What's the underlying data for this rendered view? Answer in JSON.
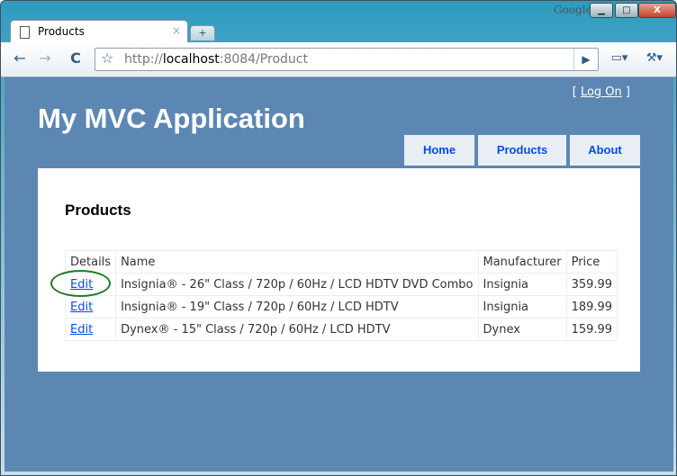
{
  "browser": {
    "brand": "Google",
    "tab_title": "Products",
    "tab_close": "×",
    "new_tab": "+",
    "url": {
      "scheme": "http://",
      "host": "localhost",
      "rest": ":8084/Product"
    },
    "window_controls": {
      "minimize": "▁",
      "maximize": "□",
      "close": "X"
    },
    "icons": {
      "back": "←",
      "forward": "→",
      "reload": "C",
      "bookmark": "☆",
      "go": "▶",
      "page_menu": "▭▾",
      "wrench_menu": "⚒▾"
    }
  },
  "site": {
    "login": {
      "open": "[",
      "link": "Log On",
      "close": "]"
    },
    "title": "My MVC Application",
    "menu": [
      "Home",
      "Products",
      "About"
    ]
  },
  "main": {
    "heading": "Products",
    "table": {
      "headers": [
        "Details",
        "Name",
        "Manufacturer",
        "Price"
      ],
      "rows": [
        {
          "action": "Edit",
          "name": "Insignia® - 26\" Class / 720p / 60Hz / LCD HDTV DVD Combo",
          "manufacturer": "Insignia",
          "price": "359.99"
        },
        {
          "action": "Edit",
          "name": "Insignia® - 19\" Class / 720p / 60Hz / LCD HDTV",
          "manufacturer": "Insignia",
          "price": "189.99"
        },
        {
          "action": "Edit",
          "name": "Dynex® - 15\" Class / 720p / 60Hz / LCD HDTV",
          "manufacturer": "Dynex",
          "price": "159.99"
        }
      ]
    }
  },
  "colors": {
    "page_background": "#5c87b2",
    "menu_text": "#034af3",
    "menu_background": "#e8eef4",
    "highlight_circle": "#1f7a28"
  }
}
